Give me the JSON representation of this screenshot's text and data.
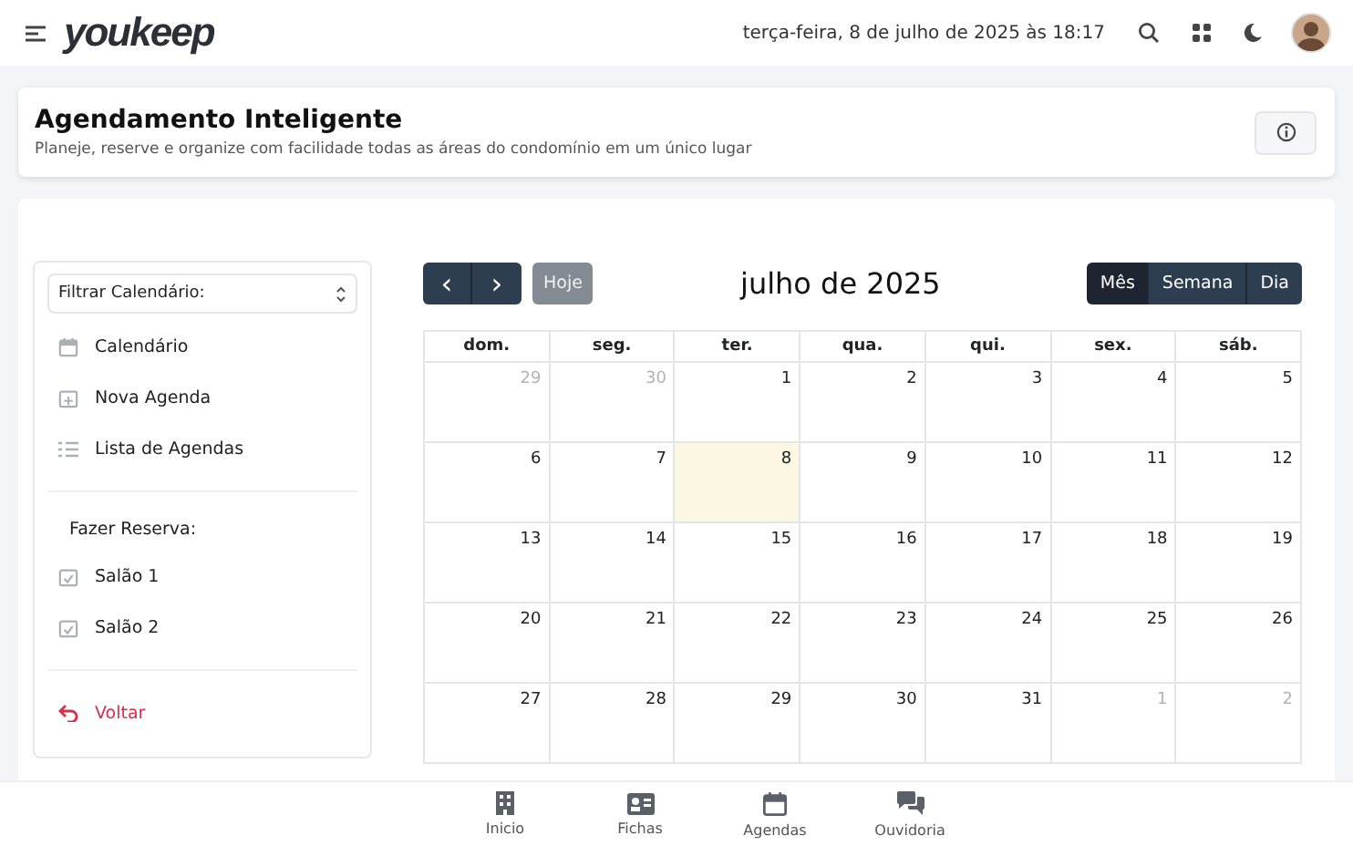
{
  "topbar": {
    "logo": "youkeep",
    "datetime": "terça-feira, 8 de julho de 2025 às 18:17"
  },
  "header": {
    "title": "Agendamento Inteligente",
    "subtitle": "Planeje, reserve e organize com facilidade todas as áreas do condomínio em um único lugar"
  },
  "sidebar": {
    "filter": "Filtrar Calendário:",
    "items": [
      {
        "kind": "calendar",
        "label": "Calendário"
      },
      {
        "kind": "new",
        "label": "Nova Agenda"
      },
      {
        "kind": "list",
        "label": "Lista de Agendas"
      }
    ],
    "reserve_heading": "Fazer Reserva:",
    "reserve_items": [
      {
        "label": "Salão 1"
      },
      {
        "label": "Salão 2"
      }
    ],
    "back": "Voltar"
  },
  "calendar": {
    "title": "julho de 2025",
    "prev": "‹",
    "next": "›",
    "today_button": "Hoje",
    "views": [
      {
        "label": "Mês",
        "selected": true
      },
      {
        "label": "Semana",
        "selected": false
      },
      {
        "label": "Dia",
        "selected": false
      }
    ],
    "weekdays": [
      "dom.",
      "seg.",
      "ter.",
      "qua.",
      "qui.",
      "sex.",
      "sáb."
    ],
    "weeks": [
      [
        {
          "day": "29",
          "outside": true,
          "today": false
        },
        {
          "day": "30",
          "outside": true,
          "today": false
        },
        {
          "day": "1",
          "outside": false,
          "today": false
        },
        {
          "day": "2",
          "outside": false,
          "today": false
        },
        {
          "day": "3",
          "outside": false,
          "today": false
        },
        {
          "day": "4",
          "outside": false,
          "today": false
        },
        {
          "day": "5",
          "outside": false,
          "today": false
        }
      ],
      [
        {
          "day": "6",
          "outside": false,
          "today": false
        },
        {
          "day": "7",
          "outside": false,
          "today": false
        },
        {
          "day": "8",
          "outside": false,
          "today": true
        },
        {
          "day": "9",
          "outside": false,
          "today": false
        },
        {
          "day": "10",
          "outside": false,
          "today": false
        },
        {
          "day": "11",
          "outside": false,
          "today": false
        },
        {
          "day": "12",
          "outside": false,
          "today": false
        }
      ],
      [
        {
          "day": "13",
          "outside": false,
          "today": false
        },
        {
          "day": "14",
          "outside": false,
          "today": false
        },
        {
          "day": "15",
          "outside": false,
          "today": false
        },
        {
          "day": "16",
          "outside": false,
          "today": false
        },
        {
          "day": "17",
          "outside": false,
          "today": false
        },
        {
          "day": "18",
          "outside": false,
          "today": false
        },
        {
          "day": "19",
          "outside": false,
          "today": false
        }
      ],
      [
        {
          "day": "20",
          "outside": false,
          "today": false
        },
        {
          "day": "21",
          "outside": false,
          "today": false
        },
        {
          "day": "22",
          "outside": false,
          "today": false
        },
        {
          "day": "23",
          "outside": false,
          "today": false
        },
        {
          "day": "24",
          "outside": false,
          "today": false
        },
        {
          "day": "25",
          "outside": false,
          "today": false
        },
        {
          "day": "26",
          "outside": false,
          "today": false
        }
      ],
      [
        {
          "day": "27",
          "outside": false,
          "today": false
        },
        {
          "day": "28",
          "outside": false,
          "today": false
        },
        {
          "day": "29",
          "outside": false,
          "today": false
        },
        {
          "day": "30",
          "outside": false,
          "today": false
        },
        {
          "day": "31",
          "outside": false,
          "today": false
        },
        {
          "day": "1",
          "outside": true,
          "today": false
        },
        {
          "day": "2",
          "outside": true,
          "today": false
        }
      ]
    ]
  },
  "bottom_nav": [
    {
      "kind": "building",
      "label": "Inicio"
    },
    {
      "kind": "card",
      "label": "Fichas"
    },
    {
      "kind": "calendar",
      "label": "Agendas"
    },
    {
      "kind": "chat",
      "label": "Ouvidoria"
    }
  ]
}
